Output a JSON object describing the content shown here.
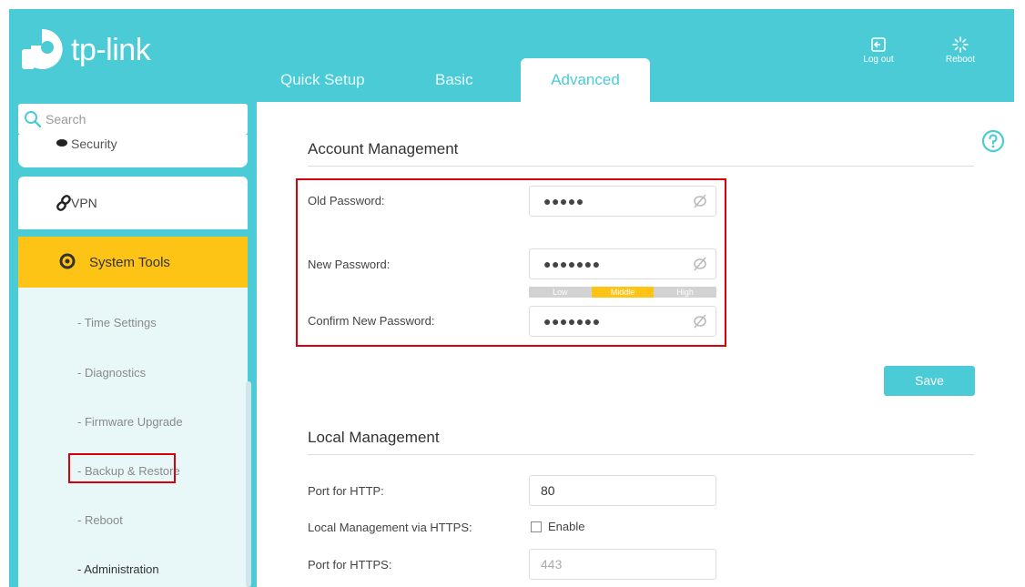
{
  "brand": {
    "logo_text": "tp-link"
  },
  "nav": {
    "tabs": [
      {
        "label": "Quick Setup"
      },
      {
        "label": "Basic"
      },
      {
        "label": "Advanced"
      }
    ],
    "active": "Advanced"
  },
  "header_actions": {
    "logout": "Log out",
    "reboot": "Reboot"
  },
  "sidebar": {
    "search_placeholder": "Search",
    "items": [
      {
        "label": "Security",
        "icon": "security-icon"
      },
      {
        "label": "VPN",
        "icon": "vpn-link-icon"
      },
      {
        "label": "System Tools",
        "icon": "gear-icon"
      }
    ],
    "submenu": [
      {
        "label": "- Time Settings"
      },
      {
        "label": "- Diagnostics"
      },
      {
        "label": "- Firmware Upgrade"
      },
      {
        "label": "- Backup & Restore"
      },
      {
        "label": "- Reboot"
      },
      {
        "label": "- Administration"
      }
    ]
  },
  "account": {
    "title": "Account Management",
    "old_password_label": "Old Password:",
    "old_password_value": "●●●●●",
    "new_password_label": "New Password:",
    "new_password_value": "●●●●●●●",
    "confirm_password_label": "Confirm New Password:",
    "confirm_password_value": "●●●●●●●",
    "strength": {
      "low": "Low",
      "middle": "Middle",
      "high": "High",
      "current": "Middle"
    },
    "save_label": "Save"
  },
  "local": {
    "title": "Local Management",
    "http_port_label": "Port for HTTP:",
    "http_port_value": "80",
    "https_label": "Local Management via HTTPS:",
    "https_enable_label": "Enable",
    "https_port_label": "Port for HTTPS:",
    "https_port_value": "443"
  },
  "colors": {
    "accent": "#4acbd6",
    "active_menu": "#fdc315",
    "highlight": "#d9000d"
  }
}
